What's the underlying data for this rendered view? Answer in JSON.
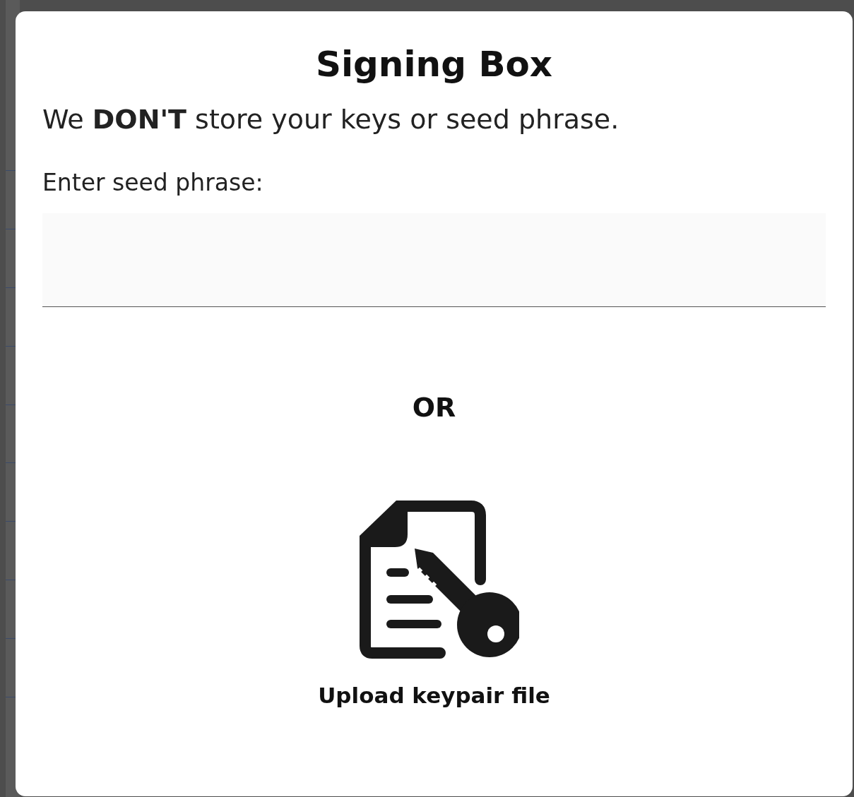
{
  "dialog": {
    "title": "Signing Box",
    "notice": "We **DON'T** store your keys or seed phrase.",
    "seed_field": {
      "label": "Enter seed phrase:"
    },
    "separator": "OR",
    "upload_button": {
      "label": "Upload keypair file"
    }
  }
}
